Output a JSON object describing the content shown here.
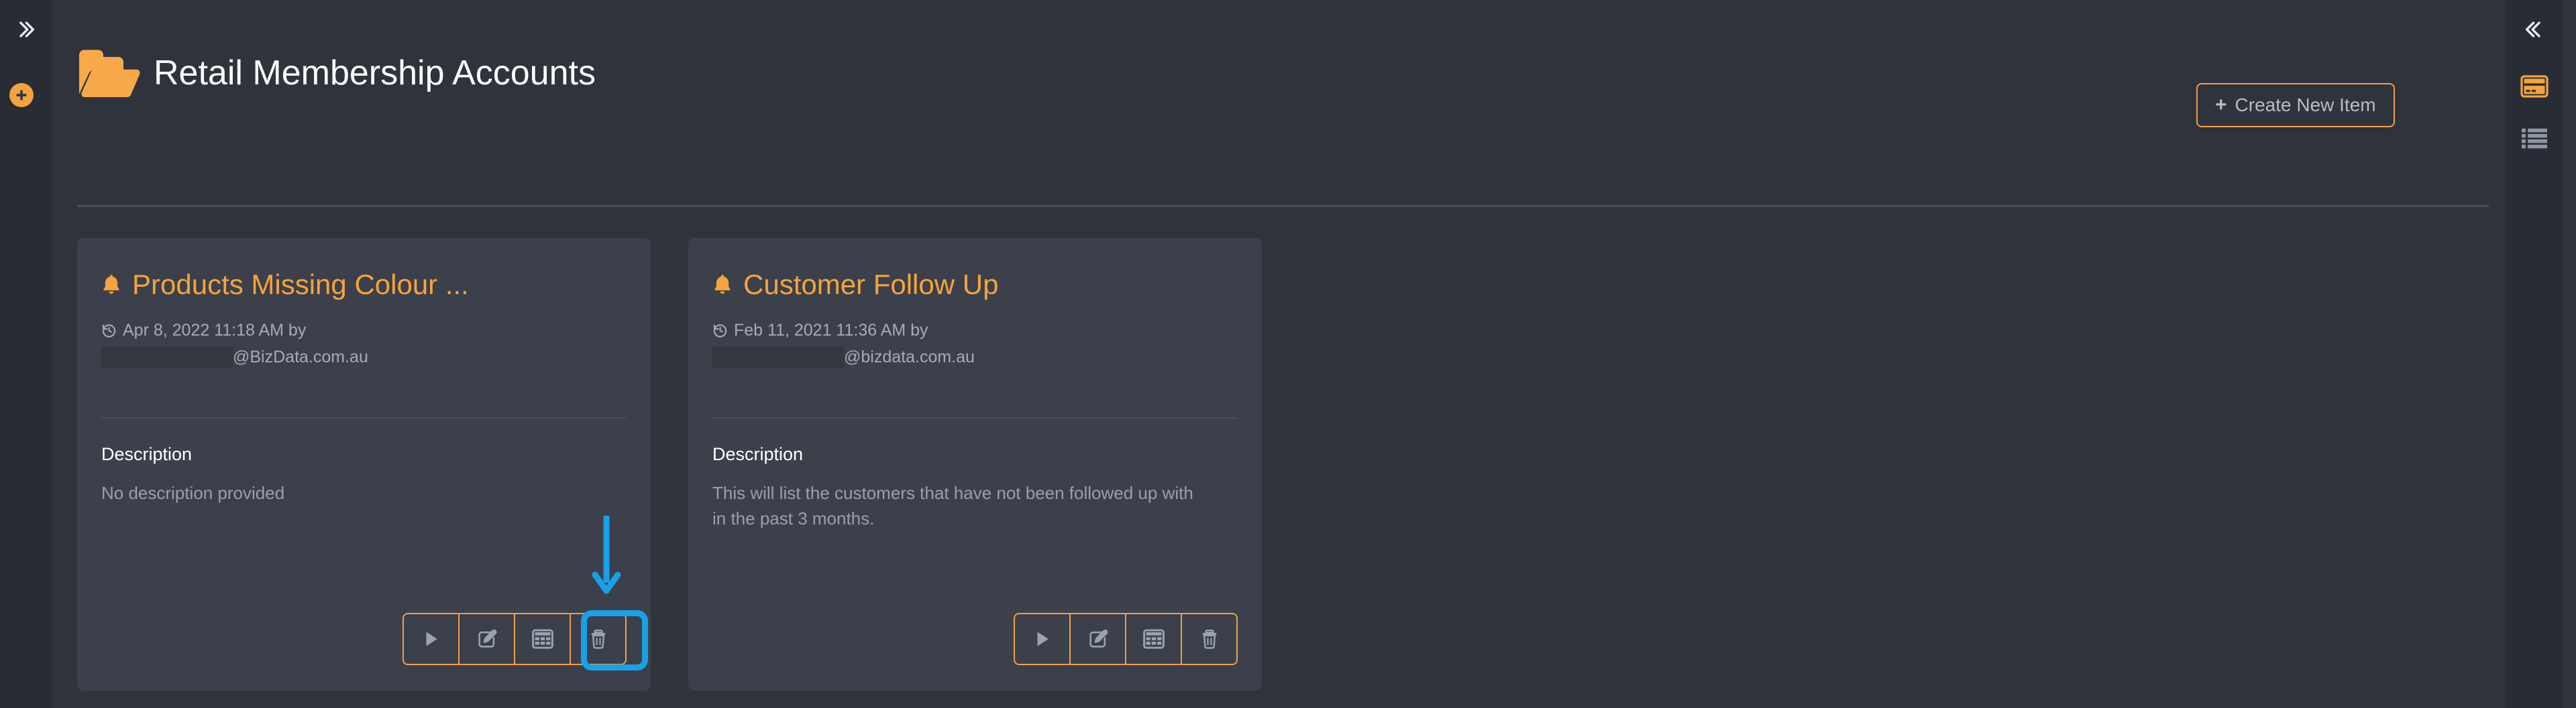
{
  "left_rail": {
    "expand_icon": "chevron-double-right-icon",
    "add_icon": "plus-circle-icon"
  },
  "right_rail": {
    "collapse_icon": "chevron-double-left-icon",
    "card_view_icon": "credit-card-icon",
    "list_view_icon": "list-icon"
  },
  "header": {
    "folder_icon": "open-folder-icon",
    "title": "Retail Membership Accounts",
    "create_button": {
      "plus": "➕",
      "plus_glyph": "+",
      "label": "Create New Item"
    }
  },
  "colors": {
    "accent_orange": "#f5a33f",
    "button_border_orange": "#f0a04b",
    "annotation_blue": "#18a0e8",
    "page_background": "#2f333c",
    "rail_background": "#282c35",
    "card_background": "#3b404a",
    "muted_text": "#9aa0ab",
    "title_text": "#ffffff"
  },
  "cards": [
    {
      "icon": "bell-icon",
      "title": "Products Missing Colour ...",
      "modified_icon": "history-icon",
      "modified_text": "Apr 8, 2022 11:18 AM by",
      "author_redacted": true,
      "author_domain": "@BizData.com.au",
      "description_label": "Description",
      "description": "No description provided",
      "actions": [
        {
          "name": "run-button",
          "icon": "play-icon"
        },
        {
          "name": "edit-button",
          "icon": "edit-pencil-icon"
        },
        {
          "name": "table-button",
          "icon": "table-grid-icon",
          "highlighted": true
        },
        {
          "name": "delete-button",
          "icon": "trash-icon"
        }
      ]
    },
    {
      "icon": "bell-icon",
      "title": "Customer Follow Up",
      "modified_icon": "history-icon",
      "modified_text": "Feb 11, 2021 11:36 AM by",
      "author_redacted": true,
      "author_domain": "@bizdata.com.au",
      "description_label": "Description",
      "description": "This will list the customers that have not been followed up with in the past 3 months.",
      "actions": [
        {
          "name": "run-button",
          "icon": "play-icon"
        },
        {
          "name": "edit-button",
          "icon": "edit-pencil-icon"
        },
        {
          "name": "table-button",
          "icon": "table-grid-icon",
          "highlighted": false
        },
        {
          "name": "delete-button",
          "icon": "trash-icon"
        }
      ]
    }
  ],
  "annotation": {
    "type": "arrow-and-highlight-box",
    "color": "#18a0e8",
    "points_to": "table-button-of-first-card"
  }
}
